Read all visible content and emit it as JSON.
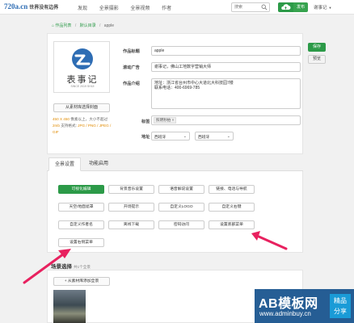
{
  "topbar": {
    "logo_site": "720a.cn",
    "logo_slogan": "世界没有边界",
    "nav": [
      "发现",
      "全景摄影",
      "全景视频",
      "作者"
    ],
    "search_placeholder": "搜索",
    "publish_label": "发布",
    "user_label": "谢事记"
  },
  "breadcrumb": {
    "items": [
      "作品列表",
      "默认目录",
      "apple"
    ]
  },
  "work": {
    "logo_text": "表事记",
    "logo_sub": "SINCE 2019 SHIJI",
    "cover_button": "从素材库选择封面",
    "hint_prefix": "450 X 450",
    "hint_middle": " 像素以上，大小不超过",
    "hint_size": "2mb",
    "hint_formats_label": " 支持格式: ",
    "hint_formats": "JPG / PNG / JPEG / GIF",
    "title_label": "作品标题",
    "title_value": "apple",
    "ad_label": "滚动广告",
    "ad_value": "谢事记，佛山工地数字营销大师",
    "intro_label": "作品介绍",
    "intro_line1": "地址：浙江省台州市中心大道北大科技园7楼",
    "intro_line2": "联系电话：400-6969-785",
    "tags_label": "标签",
    "tag_value": "照明秒拍",
    "tag_close": "×",
    "address_label": "地址",
    "province_value": "西班牙",
    "city_value": "西班牙"
  },
  "actions": {
    "save": "保存",
    "preview": "预览"
  },
  "settings": {
    "tabs": [
      "全景设置",
      "功能启用"
    ],
    "options": [
      {
        "label": "可视化编辑",
        "active": true
      },
      {
        "label": "背景音乐设置",
        "active": false
      },
      {
        "label": "语音解说设置",
        "active": false
      },
      {
        "label": "链接、电话与导航",
        "active": false
      },
      {
        "label": "天空/地面遮罩",
        "active": false
      },
      {
        "label": "开场提示",
        "active": false
      },
      {
        "label": "自定义LOGO",
        "active": false
      },
      {
        "label": "自定义右键",
        "active": false
      },
      {
        "label": "自定义作者名",
        "active": false
      },
      {
        "label": "离线下载",
        "active": false
      },
      {
        "label": "密码访问",
        "active": false
      },
      {
        "label": "设置底部菜单",
        "active": false
      },
      {
        "label": "设置右侧菜单",
        "active": false
      }
    ]
  },
  "scenes": {
    "title": "场景选择",
    "count": "共1个全景",
    "add_button": "+ 从素材库添加全景"
  },
  "watermark": {
    "big": "AB模板网",
    "url": "www.adminbuy.cn",
    "badge_line1": "精品",
    "badge_line2": "分享"
  },
  "colors": {
    "accent_green": "#2c9a48",
    "logo_blue": "#2e6db4",
    "arrow_pink": "#e8215f",
    "hint_orange": "#e08a00"
  }
}
